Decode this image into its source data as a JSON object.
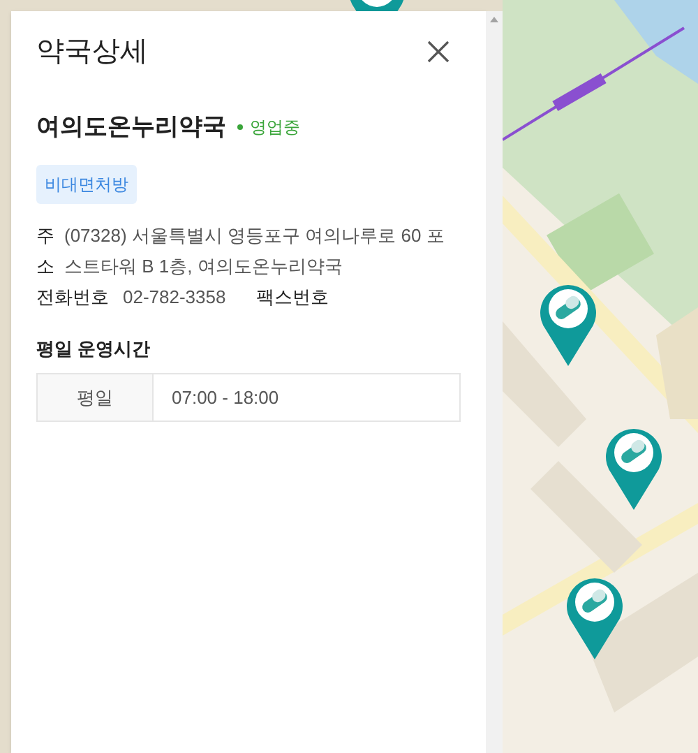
{
  "panel": {
    "title": "약국상세",
    "name": "여의도온누리약국",
    "status": {
      "label": "영업중",
      "open": true
    },
    "tags": [
      "비대면처방"
    ],
    "address": {
      "label": "주소",
      "value": "(07328) 서울특별시 영등포구 여의나루로 60 포스트타워 B 1층, 여의도온누리약국"
    },
    "phone": {
      "label": "전화번호",
      "value": "02-782-3358"
    },
    "fax": {
      "label": "팩스번호"
    },
    "hours": {
      "title": "평일 운영시간",
      "rows": [
        {
          "day": "평일",
          "time": "07:00 - 18:00"
        }
      ]
    }
  }
}
